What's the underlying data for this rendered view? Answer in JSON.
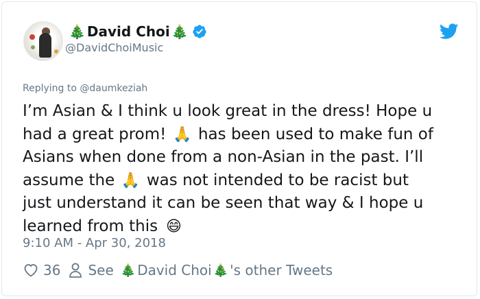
{
  "tweet": {
    "display_name": "David Choi",
    "name_emoji": "🎄",
    "handle": "@DavidChoiMusic",
    "reply_prefix": "Replying to",
    "reply_mention": "@daumkeziah",
    "text_lines": [
      {
        "parts": [
          "I’m Asian & I think u look great in the dress! Hope u"
        ]
      },
      {
        "parts": [
          "had a great prom! ",
          " has been used to make fun of"
        ]
      },
      {
        "parts": [
          "Asians when done from a non-Asian in the past. I’ll"
        ]
      },
      {
        "parts": [
          "assume the ",
          " was not intended to be racist but"
        ]
      },
      {
        "parts": [
          "just understand it can be seen that way & I hope u"
        ]
      },
      {
        "parts": [
          "learned from this "
        ]
      }
    ],
    "emoji_pray": "🙏",
    "emoji_grin": "😄",
    "timestamp": "9:10 AM - Apr 30, 2018",
    "like_count": "36",
    "see_label": "See",
    "other_tweets_name": "David Choi",
    "other_tweets_suffix": "'s other Tweets"
  },
  "colors": {
    "text": "#14171a",
    "secondary": "#657786",
    "twitter_blue": "#1da1f2",
    "border": "#e1e8ed"
  },
  "icons": [
    "avatar",
    "christmas-tree-emoji",
    "verified-badge-icon",
    "twitter-bird-icon",
    "heart-icon",
    "person-icon",
    "folded-hands-emoji",
    "grinning-emoji"
  ]
}
